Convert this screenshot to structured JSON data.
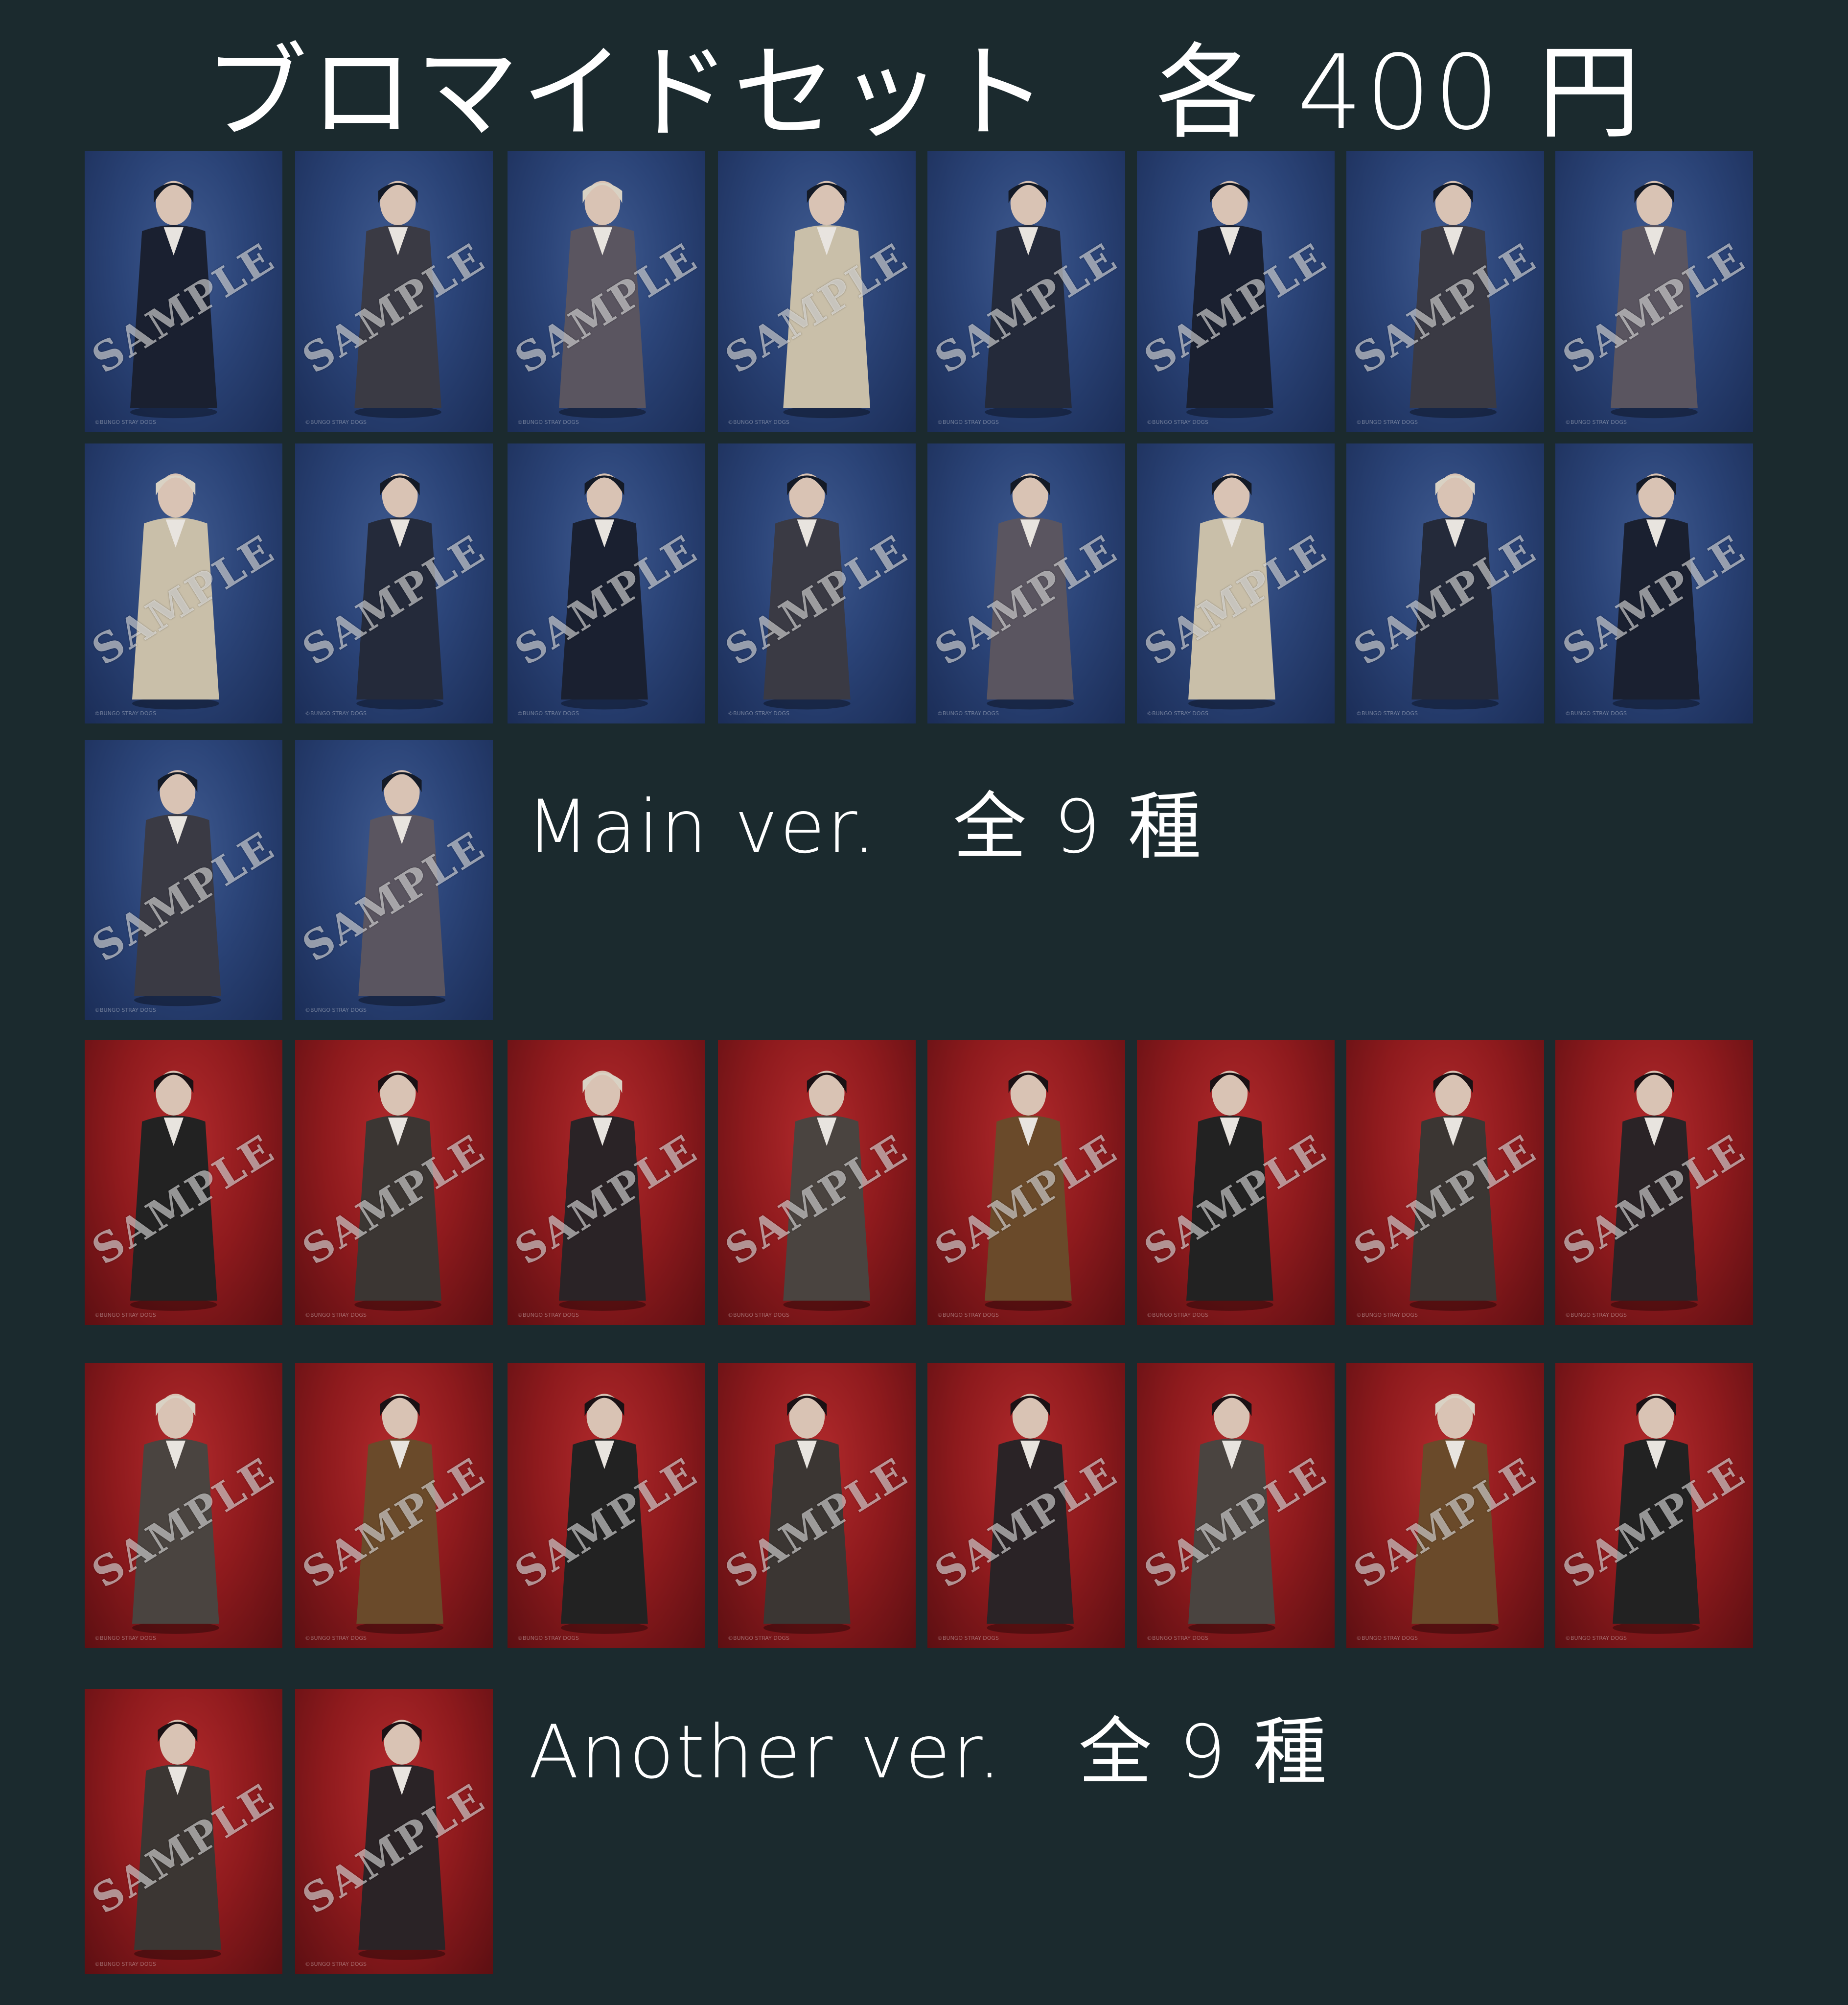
{
  "title": "ブロマイドセット　各 400 円",
  "watermark_text": "SAMPLE",
  "card_credit": "©BUNGO STRAY DOGS",
  "main_label": "Main ver.　全 9 種",
  "another_label": "Another ver.　全 9 種",
  "colors": {
    "background": "#1b2a2e",
    "main_card_bg": "#2b4478",
    "another_card_bg": "#8e1a1d",
    "text": "#ffffff"
  },
  "main_cards_count": 18,
  "another_cards_count": 18
}
